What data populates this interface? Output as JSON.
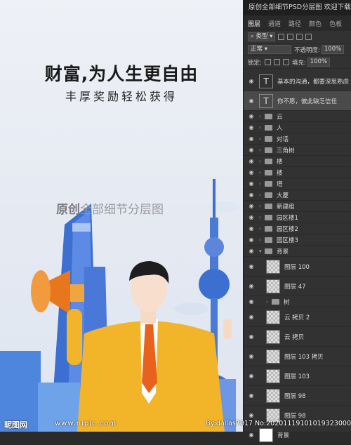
{
  "window_title": "原创全部细节PSD分层图 欢迎下载",
  "poster": {
    "title": "财富,为人生更自由",
    "subtitle": "丰厚奖励轻松获得",
    "watermark_bold": "原创",
    "watermark_rest": "全部细节分层图",
    "site_logo": "昵图网",
    "site_url": "www.nipic.com",
    "image_id": "By:dallas7017 No:20201119101019323000"
  },
  "panel": {
    "tabs": [
      "图层",
      "通道",
      "路径",
      "颜色",
      "色板"
    ],
    "active_tab": 0,
    "filter_label": "类型",
    "blend_mode": "正常",
    "opacity_label": "不透明度:",
    "opacity_value": "100%",
    "lock_label": "锁定:",
    "fill_label": "填充:",
    "fill_value": "100%",
    "layers": [
      {
        "kind": "text",
        "name": "基本的沟通，都要深思熟虑",
        "indent": 0
      },
      {
        "kind": "text",
        "name": "你不愿，彼此缺乏信任",
        "indent": 0,
        "selected": true
      },
      {
        "kind": "group",
        "name": "云",
        "indent": 0
      },
      {
        "kind": "group",
        "name": "人",
        "indent": 0
      },
      {
        "kind": "group",
        "name": "对话",
        "indent": 0
      },
      {
        "kind": "group",
        "name": "三角树",
        "indent": 0
      },
      {
        "kind": "group",
        "name": "楼",
        "indent": 0
      },
      {
        "kind": "group",
        "name": "楼",
        "indent": 0
      },
      {
        "kind": "group",
        "name": "塔",
        "indent": 0
      },
      {
        "kind": "group",
        "name": "大厦",
        "indent": 0
      },
      {
        "kind": "group",
        "name": "新建组",
        "indent": 0
      },
      {
        "kind": "group",
        "name": "园区楼1",
        "indent": 0
      },
      {
        "kind": "group",
        "name": "园区楼2",
        "indent": 0
      },
      {
        "kind": "group",
        "name": "园区楼3",
        "indent": 0
      },
      {
        "kind": "group",
        "name": "背景",
        "indent": 0,
        "open": true
      },
      {
        "kind": "image",
        "name": "图层 100",
        "indent": 1
      },
      {
        "kind": "image",
        "name": "图层 47",
        "indent": 1
      },
      {
        "kind": "group",
        "name": "树",
        "indent": 1
      },
      {
        "kind": "image",
        "name": "云 拷贝 2",
        "indent": 1
      },
      {
        "kind": "image",
        "name": "云 拷贝",
        "indent": 1
      },
      {
        "kind": "image",
        "name": "图层 103 拷贝",
        "indent": 1
      },
      {
        "kind": "image",
        "name": "图层 103",
        "indent": 1
      },
      {
        "kind": "image",
        "name": "图层 98",
        "indent": 1
      },
      {
        "kind": "image",
        "name": "图层 98",
        "indent": 1
      },
      {
        "kind": "white",
        "name": "背景",
        "indent": 0
      }
    ]
  },
  "colors": {
    "panel_bg": "#323232",
    "suit": "#f2b52a",
    "tie": "#e8611d",
    "tower_blue": "#3c6fd0",
    "megaphone": "#e8761d"
  }
}
